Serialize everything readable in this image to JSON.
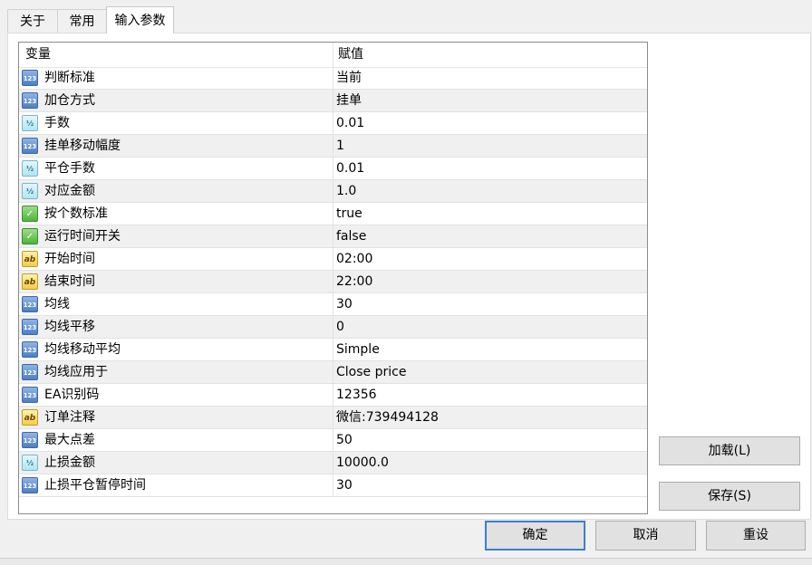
{
  "tabs": [
    {
      "label": "关于"
    },
    {
      "label": "常用"
    },
    {
      "label": "输入参数"
    }
  ],
  "grid": {
    "header": {
      "variable": "变量",
      "value": "赋值"
    },
    "rows": [
      {
        "icon": "int-type-icon",
        "type": "int",
        "name": "判断标准",
        "value": "当前"
      },
      {
        "icon": "int-type-icon",
        "type": "int",
        "name": "加仓方式",
        "value": "挂单"
      },
      {
        "icon": "double-type-icon",
        "type": "dbl",
        "name": "手数",
        "value": "0.01"
      },
      {
        "icon": "int-type-icon",
        "type": "int",
        "name": "挂单移动幅度",
        "value": "1"
      },
      {
        "icon": "double-type-icon",
        "type": "dbl",
        "name": "平仓手数",
        "value": "0.01"
      },
      {
        "icon": "double-type-icon",
        "type": "dbl",
        "name": "对应金额",
        "value": "1.0"
      },
      {
        "icon": "bool-type-icon",
        "type": "bool",
        "name": "按个数标准",
        "value": "true"
      },
      {
        "icon": "bool-type-icon",
        "type": "bool",
        "name": "运行时间开关",
        "value": "false"
      },
      {
        "icon": "string-type-icon",
        "type": "str",
        "name": "开始时间",
        "value": "02:00"
      },
      {
        "icon": "string-type-icon",
        "type": "str",
        "name": "结束时间",
        "value": "22:00"
      },
      {
        "icon": "int-type-icon",
        "type": "int",
        "name": "均线",
        "value": "30"
      },
      {
        "icon": "int-type-icon",
        "type": "int",
        "name": "均线平移",
        "value": "0"
      },
      {
        "icon": "int-type-icon",
        "type": "int",
        "name": "均线移动平均",
        "value": "Simple"
      },
      {
        "icon": "int-type-icon",
        "type": "int",
        "name": "均线应用于",
        "value": "Close price"
      },
      {
        "icon": "int-type-icon",
        "type": "int",
        "name": "EA识别码",
        "value": "12356"
      },
      {
        "icon": "string-type-icon",
        "type": "str",
        "name": "订单注释",
        "value": "微信:739494128"
      },
      {
        "icon": "int-type-icon",
        "type": "int",
        "name": "最大点差",
        "value": "50"
      },
      {
        "icon": "double-type-icon",
        "type": "dbl",
        "name": "止损金额",
        "value": "10000.0"
      },
      {
        "icon": "int-type-icon",
        "type": "int",
        "name": "止损平仓暂停时间",
        "value": "30"
      }
    ]
  },
  "buttons": {
    "load": "加载(L)",
    "save": "保存(S)",
    "ok": "确定",
    "cancel": "取消",
    "reset": "重设"
  },
  "icon_glyphs": {
    "int": "123",
    "dbl": "½",
    "bool": "✓",
    "str": "ab"
  },
  "colors": {
    "accent_border": "#3b7fd0",
    "row_alt": "#f0f0f0"
  }
}
